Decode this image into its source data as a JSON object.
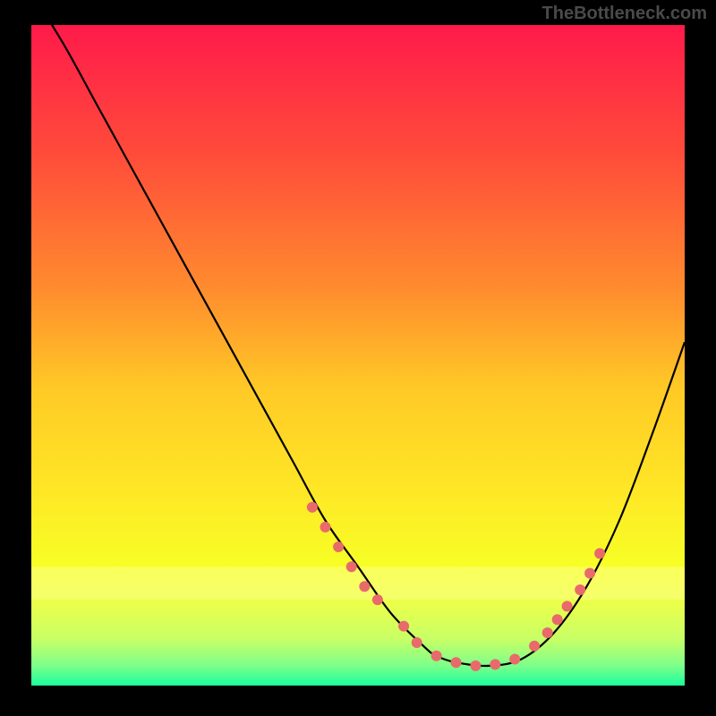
{
  "watermark": "TheBottleneck.com",
  "chart_data": {
    "type": "line",
    "title": "",
    "xlabel": "",
    "ylabel": "",
    "xlim": [
      0,
      100
    ],
    "ylim": [
      0,
      100
    ],
    "gradient_stops": [
      {
        "offset": 0,
        "color": "#ff1a4a"
      },
      {
        "offset": 20,
        "color": "#ff4d3a"
      },
      {
        "offset": 40,
        "color": "#ff8c2e"
      },
      {
        "offset": 55,
        "color": "#ffc926"
      },
      {
        "offset": 70,
        "color": "#ffe626"
      },
      {
        "offset": 82,
        "color": "#f7ff26"
      },
      {
        "offset": 88,
        "color": "#e8ff4d"
      },
      {
        "offset": 93,
        "color": "#c7ff66"
      },
      {
        "offset": 97,
        "color": "#7dff8a"
      },
      {
        "offset": 100,
        "color": "#1aff9e"
      }
    ],
    "series": [
      {
        "name": "curve",
        "color": "#000000",
        "x": [
          0,
          5,
          10,
          15,
          20,
          25,
          30,
          35,
          40,
          45,
          50,
          55,
          60,
          62,
          65,
          70,
          75,
          80,
          85,
          90,
          95,
          100
        ],
        "y": [
          105,
          97,
          88,
          79,
          70,
          61,
          52,
          43,
          34,
          25,
          18,
          11,
          6,
          4.5,
          3.5,
          3,
          4,
          8,
          15,
          25,
          38,
          52
        ]
      }
    ],
    "highlight_band": {
      "ymin": 13,
      "ymax": 18,
      "color": "#ffff99",
      "opacity": 0.45
    },
    "markers": {
      "color": "#e96a6a",
      "radius": 6,
      "points": [
        {
          "x": 43,
          "y": 27
        },
        {
          "x": 45,
          "y": 24
        },
        {
          "x": 47,
          "y": 21
        },
        {
          "x": 49,
          "y": 18
        },
        {
          "x": 51,
          "y": 15
        },
        {
          "x": 53,
          "y": 13
        },
        {
          "x": 57,
          "y": 9
        },
        {
          "x": 59,
          "y": 6.5
        },
        {
          "x": 62,
          "y": 4.5
        },
        {
          "x": 65,
          "y": 3.5
        },
        {
          "x": 68,
          "y": 3
        },
        {
          "x": 71,
          "y": 3.2
        },
        {
          "x": 74,
          "y": 4
        },
        {
          "x": 77,
          "y": 6
        },
        {
          "x": 79,
          "y": 8
        },
        {
          "x": 80.5,
          "y": 10
        },
        {
          "x": 82,
          "y": 12
        },
        {
          "x": 84,
          "y": 14.5
        },
        {
          "x": 85.5,
          "y": 17
        },
        {
          "x": 87,
          "y": 20
        }
      ]
    }
  }
}
